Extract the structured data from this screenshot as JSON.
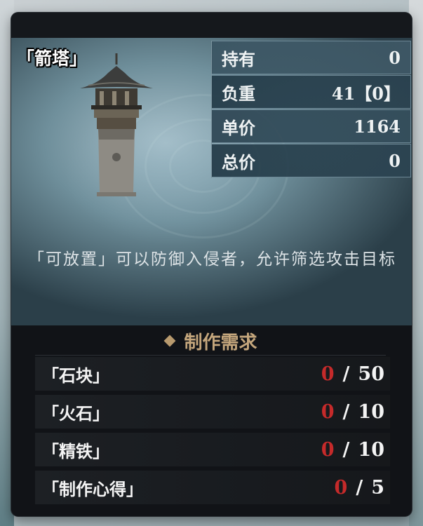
{
  "item": {
    "title": "「箭塔」",
    "stats": [
      {
        "label": "持有",
        "value": "0"
      },
      {
        "label": "负重",
        "value": "41【0】"
      },
      {
        "label": "单价",
        "value": "1164"
      },
      {
        "label": "总价",
        "value": "0"
      }
    ],
    "description": "「可放置」可以防御入侵者，允许筛选攻击目标"
  },
  "requirements": {
    "header": "制作需求",
    "separator": "/",
    "items": [
      {
        "name": "「石块」",
        "have": "0",
        "need": "50"
      },
      {
        "name": "「火石」",
        "have": "0",
        "need": "10"
      },
      {
        "name": "「精铁」",
        "have": "0",
        "need": "10"
      },
      {
        "name": "「制作心得」",
        "have": "0",
        "need": "5"
      }
    ]
  },
  "colors": {
    "accent_gold": "#c4a67c",
    "insufficient_red": "#c52a2a",
    "panel_bg": "#111317"
  },
  "icons": {
    "item_image": "arrow-tower",
    "header_marker": "diamond-icon"
  }
}
